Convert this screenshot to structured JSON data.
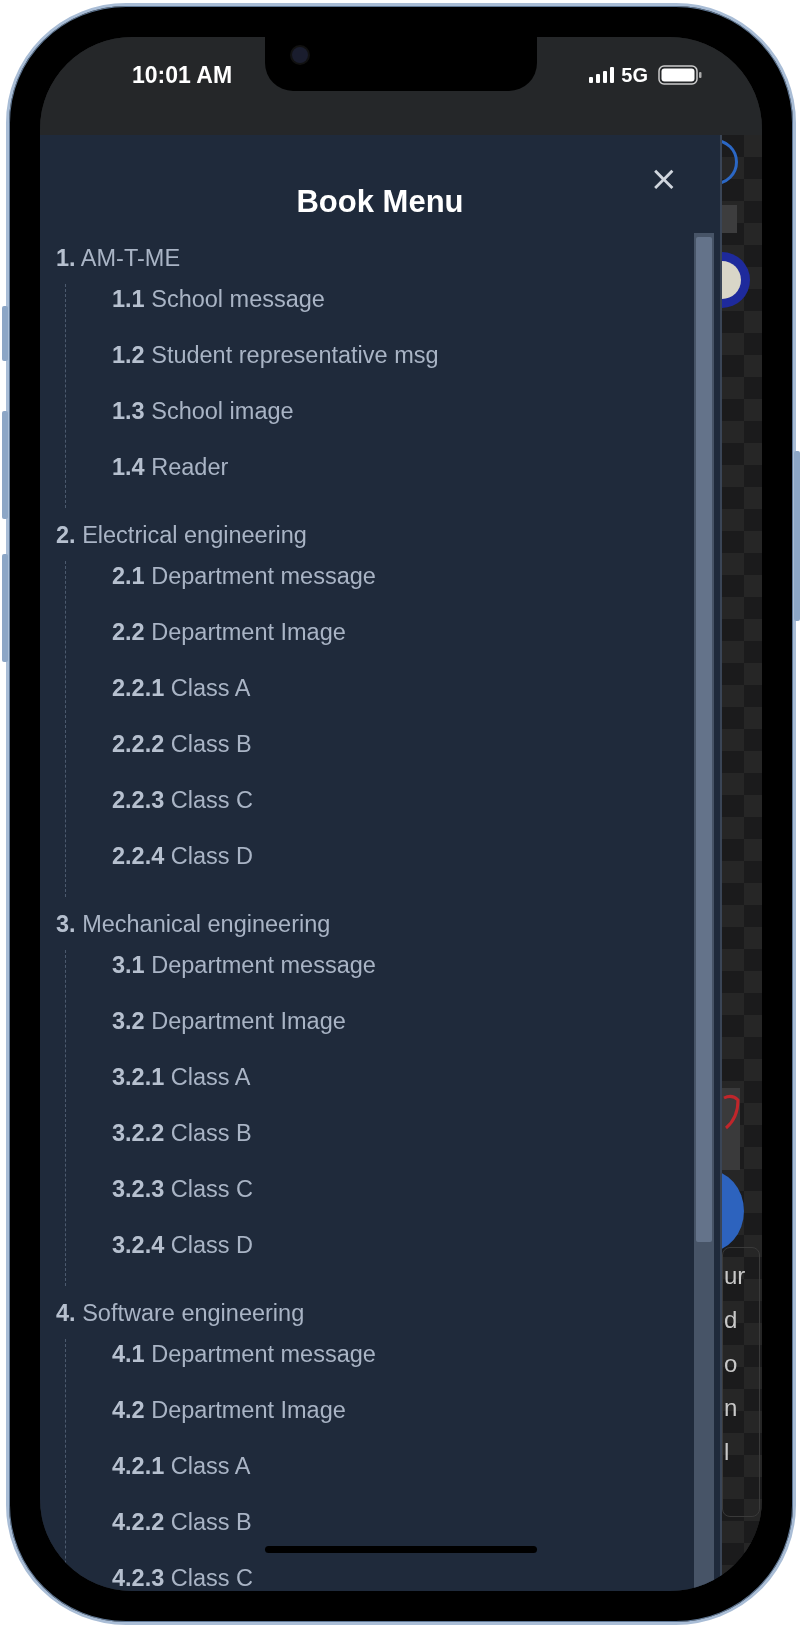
{
  "status_bar": {
    "time": "10:01 AM",
    "network": "5G"
  },
  "drawer": {
    "title": "Book Menu",
    "close_label": "×",
    "sections": [
      {
        "number": "1.",
        "label": "AM-T-ME",
        "children": [
          {
            "number": "1.1",
            "label": "School message"
          },
          {
            "number": "1.2",
            "label": "Student representative msg"
          },
          {
            "number": "1.3",
            "label": "School image"
          },
          {
            "number": "1.4",
            "label": "Reader"
          }
        ]
      },
      {
        "number": "2.",
        "label": "Electrical engineering",
        "children": [
          {
            "number": "2.1",
            "label": "Department message"
          },
          {
            "number": "2.2",
            "label": "Department Image"
          },
          {
            "number": "2.2.1",
            "label": "Class A"
          },
          {
            "number": "2.2.2",
            "label": "Class B"
          },
          {
            "number": "2.2.3",
            "label": "Class C"
          },
          {
            "number": "2.2.4",
            "label": "Class D"
          }
        ]
      },
      {
        "number": "3.",
        "label": "Mechanical engineering",
        "children": [
          {
            "number": "3.1",
            "label": "Department message"
          },
          {
            "number": "3.2",
            "label": "Department Image"
          },
          {
            "number": "3.2.1",
            "label": "Class A"
          },
          {
            "number": "3.2.2",
            "label": "Class B"
          },
          {
            "number": "3.2.3",
            "label": "Class C"
          },
          {
            "number": "3.2.4",
            "label": "Class D"
          }
        ]
      },
      {
        "number": "4.",
        "label": "Software engineering",
        "children": [
          {
            "number": "4.1",
            "label": "Department message"
          },
          {
            "number": "4.2",
            "label": "Department Image"
          },
          {
            "number": "4.2.1",
            "label": "Class A"
          },
          {
            "number": "4.2.2",
            "label": "Class B"
          },
          {
            "number": "4.2.3",
            "label": "Class C"
          }
        ]
      }
    ]
  },
  "background_page": {
    "text_fragments": [
      "ur",
      "d",
      "o",
      "n",
      "l"
    ]
  }
}
